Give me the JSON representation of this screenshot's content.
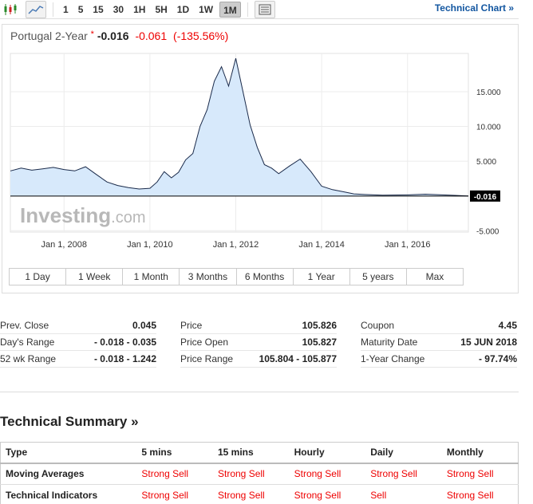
{
  "toolbar": {
    "icons": [
      "candlestick-icon",
      "line-chart-icon",
      "settings-panel-icon"
    ],
    "timeframes": [
      "1",
      "5",
      "15",
      "30",
      "1H",
      "5H",
      "1D",
      "1W",
      "1M"
    ],
    "active_timeframe": "1M",
    "technical_chart_label": "Technical Chart »"
  },
  "quote": {
    "name": "Portugal 2-Year",
    "star": "*",
    "last": "-0.016",
    "change": "-0.061",
    "change_pct": "(-135.56%)"
  },
  "watermark": {
    "brand": "Investing",
    "suffix": ".com"
  },
  "colors": {
    "line": "#1a2a4a",
    "area": "#d7e9fb",
    "negative": "#ee0000",
    "link": "#1256a0"
  },
  "chart_data": {
    "type": "area",
    "x": [
      "2006-10",
      "2007-01",
      "2007-04",
      "2007-07",
      "2007-10",
      "2008-01",
      "2008-04",
      "2008-07",
      "2008-10",
      "2009-01",
      "2009-04",
      "2009-07",
      "2009-10",
      "2010-01",
      "2010-03",
      "2010-05",
      "2010-07",
      "2010-09",
      "2010-11",
      "2011-01",
      "2011-03",
      "2011-05",
      "2011-07",
      "2011-09",
      "2011-11",
      "2012-01",
      "2012-03",
      "2012-05",
      "2012-07",
      "2012-09",
      "2012-11",
      "2013-01",
      "2013-04",
      "2013-07",
      "2013-10",
      "2014-01",
      "2014-04",
      "2014-07",
      "2014-10",
      "2015-01",
      "2015-06",
      "2016-01",
      "2016-06",
      "2017-01",
      "2017-06"
    ],
    "y": [
      3.6,
      4.0,
      3.7,
      3.9,
      4.1,
      3.8,
      3.6,
      4.2,
      3.1,
      2.0,
      1.5,
      1.2,
      1.0,
      1.1,
      2.0,
      3.5,
      2.6,
      3.4,
      5.2,
      6.1,
      10.0,
      12.4,
      16.5,
      18.6,
      15.8,
      19.8,
      15.0,
      10.2,
      7.0,
      4.5,
      4.0,
      3.2,
      4.3,
      5.3,
      3.5,
      1.4,
      0.9,
      0.6,
      0.3,
      0.2,
      0.1,
      0.15,
      0.25,
      0.1,
      -0.016
    ],
    "last_value": "-0.016",
    "yticks": [
      "15.000",
      "10.000",
      "5.000",
      "-5.000"
    ],
    "ytick_values": [
      15,
      10,
      5,
      -5
    ],
    "xticks": [
      "Jan 1, 2008",
      "Jan 1, 2010",
      "Jan 1, 2012",
      "Jan 1, 2014",
      "Jan 1, 2016"
    ],
    "ylim": [
      -5.2,
      20.5
    ],
    "grid": true
  },
  "ranges": [
    "1 Day",
    "1 Week",
    "1 Month",
    "3 Months",
    "6 Months",
    "1 Year",
    "5 years",
    "Max"
  ],
  "stats": {
    "col1": [
      {
        "label": "Prev. Close",
        "value": "0.045"
      },
      {
        "label": "Day's Range",
        "value": "- 0.018 - 0.035"
      },
      {
        "label": "52 wk Range",
        "value": "- 0.018 - 1.242"
      }
    ],
    "col2": [
      {
        "label": "Price",
        "value": "105.826"
      },
      {
        "label": "Price Open",
        "value": "105.827"
      },
      {
        "label": "Price Range",
        "value": "105.804 - 105.877"
      }
    ],
    "col3": [
      {
        "label": "Coupon",
        "value": "4.45"
      },
      {
        "label": "Maturity Date",
        "value": "15 JUN 2018"
      },
      {
        "label": "1-Year Change",
        "value": "- 97.74%"
      }
    ]
  },
  "technical_summary": {
    "title": "Technical Summary »",
    "headers": [
      "Type",
      "5 mins",
      "15 mins",
      "Hourly",
      "Daily",
      "Monthly"
    ],
    "rows": [
      {
        "type": "Moving Averages",
        "values": [
          "Strong Sell",
          "Strong Sell",
          "Strong Sell",
          "Strong Sell",
          "Strong Sell"
        ]
      },
      {
        "type": "Technical Indicators",
        "values": [
          "Strong Sell",
          "Strong Sell",
          "Strong Sell",
          "Sell",
          "Strong Sell"
        ]
      }
    ]
  }
}
